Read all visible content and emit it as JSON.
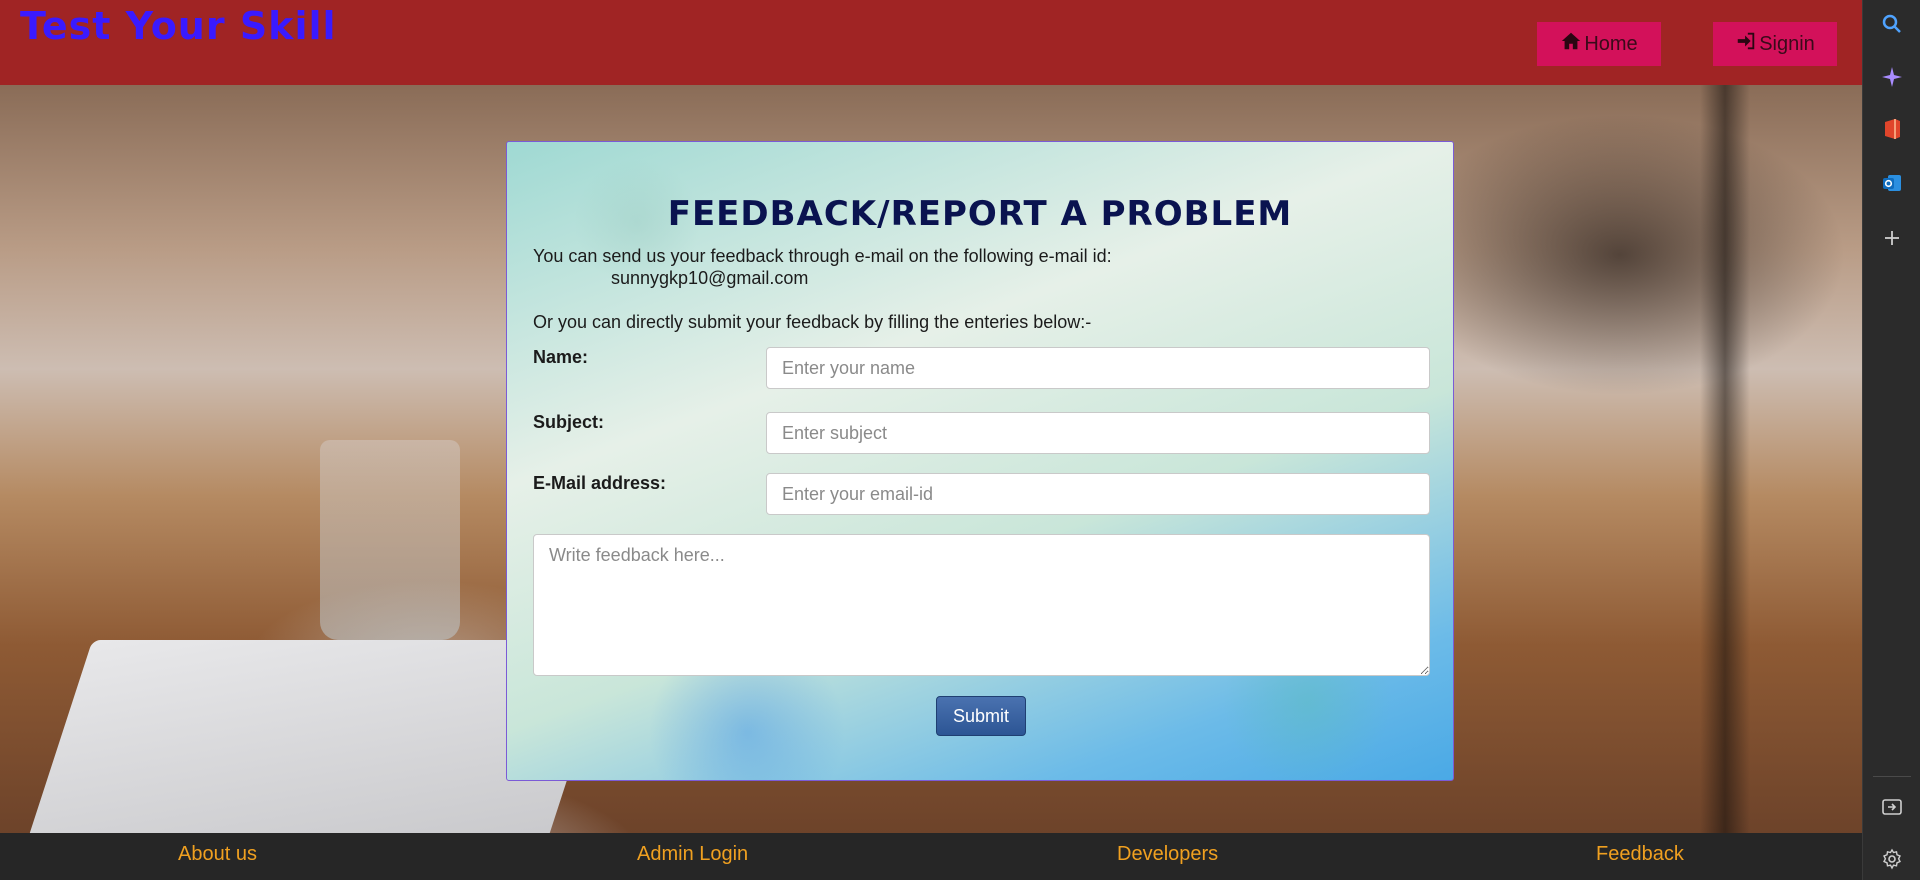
{
  "header": {
    "brand": "Test Your Skill",
    "home_label": "Home",
    "signin_label": "Signin"
  },
  "form": {
    "title": "FEEDBACK/REPORT A PROBLEM",
    "intro_line": "You can send us your feedback through e-mail on the following e-mail id:",
    "email": "sunnygkp10@gmail.com",
    "alt_line": "Or you can directly submit your feedback by filling the enteries below:-",
    "name_label": "Name:",
    "name_placeholder": "Enter your name",
    "subject_label": "Subject:",
    "subject_placeholder": "Enter subject",
    "email_label": "E-Mail address:",
    "email_placeholder": "Enter your email-id",
    "feedback_placeholder": "Write feedback here...",
    "submit_label": "Submit"
  },
  "footer": {
    "links": [
      "About us",
      "Admin Login",
      "Developers",
      "Feedback"
    ]
  },
  "browser_sidebar": {
    "icons": [
      "search-icon",
      "copilot-icon",
      "office-icon",
      "outlook-icon",
      "add-icon",
      "collapse-sidebar-icon",
      "settings-icon"
    ]
  },
  "colors": {
    "topbar": "#a02424",
    "brand_text": "#3a1aff",
    "nav_button": "#d3115a",
    "footer_bg": "#262626",
    "footer_link": "#f0a020",
    "title_text": "#0a1350",
    "submit_bg": "#2c5594"
  }
}
